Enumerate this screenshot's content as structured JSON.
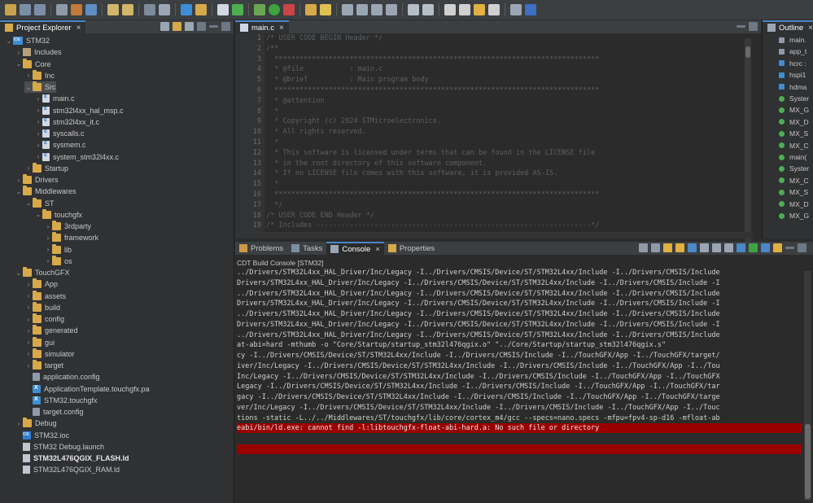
{
  "colors": {
    "accent": "#4a88c7",
    "error_bg": "#9b0000",
    "folder": "#d7a94a"
  },
  "explorer": {
    "tab_label": "Project Explorer",
    "tree": [
      {
        "label": "STM32",
        "icon": "project-icon",
        "depth": 0,
        "expanded": true,
        "bold": false
      },
      {
        "label": "Includes",
        "icon": "includes-icon",
        "depth": 1,
        "expanded": false
      },
      {
        "label": "Core",
        "icon": "folder-icon",
        "depth": 1,
        "expanded": true
      },
      {
        "label": "Inc",
        "icon": "folder-icon",
        "depth": 2,
        "expanded": false
      },
      {
        "label": "Src",
        "icon": "folder-icon",
        "depth": 2,
        "expanded": true,
        "selected": true
      },
      {
        "label": "main.c",
        "icon": "c-file-icon",
        "depth": 3,
        "expanded": false
      },
      {
        "label": "stm32l4xx_hal_msp.c",
        "icon": "c-file-icon",
        "depth": 3,
        "expanded": false
      },
      {
        "label": "stm32l4xx_it.c",
        "icon": "c-file-icon",
        "depth": 3,
        "expanded": false
      },
      {
        "label": "syscalls.c",
        "icon": "c-file-icon",
        "depth": 3,
        "expanded": false
      },
      {
        "label": "sysmem.c",
        "icon": "c-file-icon",
        "depth": 3,
        "expanded": false
      },
      {
        "label": "system_stm32l4xx.c",
        "icon": "c-file-icon",
        "depth": 3,
        "expanded": false
      },
      {
        "label": "Startup",
        "icon": "folder-icon",
        "depth": 2,
        "expanded": false
      },
      {
        "label": "Drivers",
        "icon": "folder-icon",
        "depth": 1,
        "expanded": false
      },
      {
        "label": "Middlewares",
        "icon": "folder-icon",
        "depth": 1,
        "expanded": true
      },
      {
        "label": "ST",
        "icon": "folder-icon",
        "depth": 2,
        "expanded": true
      },
      {
        "label": "touchgfx",
        "icon": "folder-icon",
        "depth": 3,
        "expanded": true
      },
      {
        "label": "3rdparty",
        "icon": "folder-icon",
        "depth": 4,
        "expanded": false
      },
      {
        "label": "framework",
        "icon": "folder-icon",
        "depth": 4,
        "expanded": false
      },
      {
        "label": "lib",
        "icon": "folder-icon",
        "depth": 4,
        "expanded": false
      },
      {
        "label": "os",
        "icon": "folder-icon",
        "depth": 4,
        "expanded": false
      },
      {
        "label": "TouchGFX",
        "icon": "folder-icon",
        "depth": 1,
        "expanded": true
      },
      {
        "label": "App",
        "icon": "folder-icon",
        "depth": 2,
        "expanded": false
      },
      {
        "label": "assets",
        "icon": "folder-icon",
        "depth": 2,
        "expanded": false
      },
      {
        "label": "build",
        "icon": "folder-icon",
        "depth": 2,
        "expanded": false
      },
      {
        "label": "config",
        "icon": "folder-icon",
        "depth": 2,
        "expanded": false
      },
      {
        "label": "generated",
        "icon": "folder-icon",
        "depth": 2,
        "expanded": false
      },
      {
        "label": "gui",
        "icon": "folder-icon",
        "depth": 2,
        "expanded": false
      },
      {
        "label": "simulator",
        "icon": "folder-icon",
        "depth": 2,
        "expanded": false
      },
      {
        "label": "target",
        "icon": "folder-icon",
        "depth": 2,
        "expanded": false
      },
      {
        "label": "application.config",
        "icon": "config-file-icon",
        "depth": 2,
        "leaf": true
      },
      {
        "label": "ApplicationTemplate.touchgfx.pa",
        "icon": "touchgfx-file-icon",
        "depth": 2,
        "leaf": true
      },
      {
        "label": "STM32.touchgfx",
        "icon": "touchgfx-file-icon",
        "depth": 2,
        "leaf": true
      },
      {
        "label": "target.config",
        "icon": "config-file-icon",
        "depth": 2,
        "leaf": true
      },
      {
        "label": "Debug",
        "icon": "folder-icon",
        "depth": 1,
        "expanded": false
      },
      {
        "label": "STM32.ioc",
        "icon": "ioc-file-icon",
        "depth": 1,
        "leaf": true
      },
      {
        "label": "STM32 Debug.launch",
        "icon": "launch-file-icon",
        "depth": 1,
        "leaf": true
      },
      {
        "label": "STM32L476QGIX_FLASH.ld",
        "icon": "linker-file-icon",
        "depth": 1,
        "leaf": true,
        "bold": true
      },
      {
        "label": "STM32L476QGIX_RAM.ld",
        "icon": "linker-file-icon",
        "depth": 1,
        "leaf": true
      }
    ]
  },
  "editor": {
    "tab_label": "main.c",
    "lines": [
      {
        "n": "1",
        "text": "/* USER CODE BEGIN Header */"
      },
      {
        "n": "2",
        "text": "/**"
      },
      {
        "n": "3",
        "text": "  ******************************************************************************"
      },
      {
        "n": "4",
        "text": "  * @file           : main.c"
      },
      {
        "n": "5",
        "text": "  * @brief          : Main program body"
      },
      {
        "n": "6",
        "text": "  ******************************************************************************"
      },
      {
        "n": "7",
        "text": "  * @attention"
      },
      {
        "n": "8",
        "text": "  *"
      },
      {
        "n": "9",
        "text": "  * Copyright (c) 2024 STMicroelectronics."
      },
      {
        "n": "10",
        "text": "  * All rights reserved."
      },
      {
        "n": "11",
        "text": "  *"
      },
      {
        "n": "12",
        "text": "  * This software is licensed under terms that can be found in the LICENSE file"
      },
      {
        "n": "13",
        "text": "  * in the root directory of this software component."
      },
      {
        "n": "14",
        "text": "  * If no LICENSE file comes with this software, it is provided AS-IS."
      },
      {
        "n": "15",
        "text": "  *"
      },
      {
        "n": "16",
        "text": "  ******************************************************************************"
      },
      {
        "n": "17",
        "text": "  */"
      },
      {
        "n": "18",
        "text": "/* USER CODE END Header */"
      },
      {
        "n": "19",
        "text": "/* Includes ------------------------------------------------------------------*/"
      }
    ]
  },
  "outline": {
    "tab_label": "Outline",
    "items": [
      {
        "label": "main.",
        "color": "#8e9aa8"
      },
      {
        "label": "app_t",
        "color": "#8e9aa8"
      },
      {
        "label": "hcrc :",
        "color": "#3d8ed4"
      },
      {
        "label": "hspi1",
        "color": "#3d8ed4"
      },
      {
        "label": "hdma",
        "color": "#3d8ed4"
      },
      {
        "label": "Syster",
        "color": "#4caf50"
      },
      {
        "label": "MX_G",
        "color": "#4caf50"
      },
      {
        "label": "MX_D",
        "color": "#4caf50"
      },
      {
        "label": "MX_S",
        "color": "#4caf50"
      },
      {
        "label": "MX_C",
        "color": "#4caf50"
      },
      {
        "label": "main(",
        "color": "#4caf50"
      },
      {
        "label": "Syster",
        "color": "#4caf50"
      },
      {
        "label": "MX_C",
        "color": "#4caf50"
      },
      {
        "label": "MX_S",
        "color": "#4caf50"
      },
      {
        "label": "MX_D",
        "color": "#4caf50"
      },
      {
        "label": "MX_G",
        "color": "#4caf50"
      }
    ]
  },
  "console": {
    "tabs": [
      {
        "label": "Problems",
        "active": false
      },
      {
        "label": "Tasks",
        "active": false
      },
      {
        "label": "Console",
        "active": true
      },
      {
        "label": "Properties",
        "active": false
      }
    ],
    "title": "CDT Build Console [STM32]",
    "lines": [
      {
        "text": "../Drivers/STM32L4xx_HAL_Driver/Inc/Legacy -I../Drivers/CMSIS/Device/ST/STM32L4xx/Include -I../Drivers/CMSIS/Include",
        "err": false
      },
      {
        "text": "Drivers/STM32L4xx_HAL_Driver/Inc/Legacy -I../Drivers/CMSIS/Device/ST/STM32L4xx/Include -I../Drivers/CMSIS/Include -I",
        "err": false
      },
      {
        "text": "../Drivers/STM32L4xx_HAL_Driver/Inc/Legacy -I../Drivers/CMSIS/Device/ST/STM32L4xx/Include -I../Drivers/CMSIS/Include",
        "err": false
      },
      {
        "text": "Drivers/STM32L4xx_HAL_Driver/Inc/Legacy -I../Drivers/CMSIS/Device/ST/STM32L4xx/Include -I../Drivers/CMSIS/Include -I",
        "err": false
      },
      {
        "text": "../Drivers/STM32L4xx_HAL_Driver/Inc/Legacy -I../Drivers/CMSIS/Device/ST/STM32L4xx/Include -I../Drivers/CMSIS/Include",
        "err": false
      },
      {
        "text": "Drivers/STM32L4xx_HAL_Driver/Inc/Legacy -I../Drivers/CMSIS/Device/ST/STM32L4xx/Include -I../Drivers/CMSIS/Include -I",
        "err": false
      },
      {
        "text": "../Drivers/STM32L4xx_HAL_Driver/Inc/Legacy -I../Drivers/CMSIS/Device/ST/STM32L4xx/Include -I../Drivers/CMSIS/Include",
        "err": false
      },
      {
        "text": "at-abi=hard -mthumb -o \"Core/Startup/startup_stm32l476qgix.o\" \"../Core/Startup/startup_stm32l476qgix.s\"",
        "err": false
      },
      {
        "text": "cy -I../Drivers/CMSIS/Device/ST/STM32L4xx/Include -I../Drivers/CMSIS/Include -I../TouchGFX/App -I../TouchGFX/target/",
        "err": false
      },
      {
        "text": "iver/Inc/Legacy -I../Drivers/CMSIS/Device/ST/STM32L4xx/Include -I../Drivers/CMSIS/Include -I../TouchGFX/App -I../Tou",
        "err": false
      },
      {
        "text": "Inc/Legacy -I../Drivers/CMSIS/Device/ST/STM32L4xx/Include -I../Drivers/CMSIS/Include -I../TouchGFX/App -I../TouchGFX",
        "err": false
      },
      {
        "text": "Legacy -I../Drivers/CMSIS/Device/ST/STM32L4xx/Include -I../Drivers/CMSIS/Include -I../TouchGFX/App -I../TouchGFX/tar",
        "err": false
      },
      {
        "text": "gacy -I../Drivers/CMSIS/Device/ST/STM32L4xx/Include -I../Drivers/CMSIS/Include -I../TouchGFX/App -I../TouchGFX/targe",
        "err": false
      },
      {
        "text": "ver/Inc/Legacy -I../Drivers/CMSIS/Device/ST/STM32L4xx/Include -I../Drivers/CMSIS/Include -I../TouchGFX/App -I../Touc",
        "err": false
      },
      {
        "text": "tions -static -L../../Middlewares/ST/touchgfx/lib/core/cortex_m4/gcc --specs=nano.specs -mfpu=fpv4-sp-d16 -mfloat-ab",
        "err": false
      },
      {
        "text": "eabi/bin/ld.exe: cannot find -l:libtouchgfx-float-abi-hard.a: No such file or directory",
        "err": true
      },
      {
        "text": "",
        "err": false
      },
      {
        "text": "",
        "err": true
      }
    ]
  }
}
